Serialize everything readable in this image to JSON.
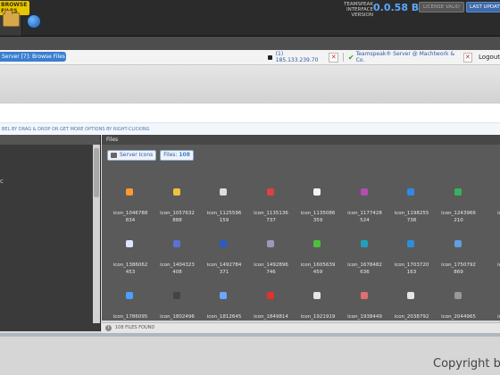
{
  "header": {
    "browse_badge": "BROWSE FILES",
    "app_title": "TEAMSPEAK INTERFACE",
    "version_label": "VERSION",
    "version": "0.0.58 BE",
    "license_button": "LICENSE VALID",
    "last_update_button": "LAST UPDATE"
  },
  "nav": {
    "tab_label": "Server [7]: Browse Files",
    "ip": "(1) 185.133.239.70",
    "server_name": "Teamspeak® Server @ Machtwork & Co.",
    "logout": "Logout"
  },
  "hint": "BEL BY DRAG & DROP OR GET MORE OPTIONS BY RIGHT-CLICKING",
  "right_panel": {
    "title": "Files",
    "server_icons_button": "Server Icons",
    "files_label": "Files:",
    "files_count": "108",
    "items": [
      {
        "line1": "icon_1046788",
        "line2": "834",
        "color": "#ff9933"
      },
      {
        "line1": "icon_1057632",
        "line2": "888",
        "color": "#f0c040"
      },
      {
        "line1": "icon_1125596",
        "line2": "159",
        "color": "#dddddd"
      },
      {
        "line1": "icon_1135136",
        "line2": "737",
        "color": "#e04040"
      },
      {
        "line1": "icon_1135086",
        "line2": "359",
        "color": "#f2f2f2"
      },
      {
        "line1": "icon_1177428",
        "line2": "524",
        "color": "#b24db2"
      },
      {
        "line1": "icon_1198255",
        "line2": "738",
        "color": "#2f8ae6"
      },
      {
        "line1": "icon_1243966",
        "line2": "210",
        "color": "#33b35a"
      },
      {
        "line1": "icon_1",
        "line2": "7",
        "color": "#cccccc"
      },
      {
        "line1": "icon_1386062",
        "line2": "453",
        "color": "#dde6ff"
      },
      {
        "line1": "icon_1404323",
        "line2": "408",
        "color": "#5a72d6"
      },
      {
        "line1": "icon_1492784",
        "line2": "371",
        "color": "#2a5bc7"
      },
      {
        "line1": "icon_1492896",
        "line2": "746",
        "color": "#9a9ab5"
      },
      {
        "line1": "icon_1605639",
        "line2": "459",
        "color": "#4fbf3c"
      },
      {
        "line1": "icon_1678482",
        "line2": "636",
        "color": "#20a0c0"
      },
      {
        "line1": "icon_1703720",
        "line2": "163",
        "color": "#2a8fdb"
      },
      {
        "line1": "icon_1750792",
        "line2": "869",
        "color": "#5ea0e0"
      },
      {
        "line1": "icon_1",
        "line2": "6",
        "color": "#cccccc"
      },
      {
        "line1": "icon_1786095",
        "line2": "",
        "color": "#4aa0ff"
      },
      {
        "line1": "icon_1802496",
        "line2": "",
        "color": "#444444"
      },
      {
        "line1": "icon_1812645",
        "line2": "",
        "color": "#6aa7ff"
      },
      {
        "line1": "icon_1849814",
        "line2": "",
        "color": "#e0342c"
      },
      {
        "line1": "icon_1921919",
        "line2": "",
        "color": "#e6e6e6"
      },
      {
        "line1": "icon_1938449",
        "line2": "",
        "color": "#e07070"
      },
      {
        "line1": "icon_2038792",
        "line2": "",
        "color": "#e6e6e6"
      },
      {
        "line1": "icon_2044965",
        "line2": "",
        "color": "#999999"
      },
      {
        "line1": "icon_2",
        "line2": "",
        "color": "#cccccc"
      }
    ]
  },
  "status": "108 FILES FOUND",
  "copyright": "Copyright b"
}
